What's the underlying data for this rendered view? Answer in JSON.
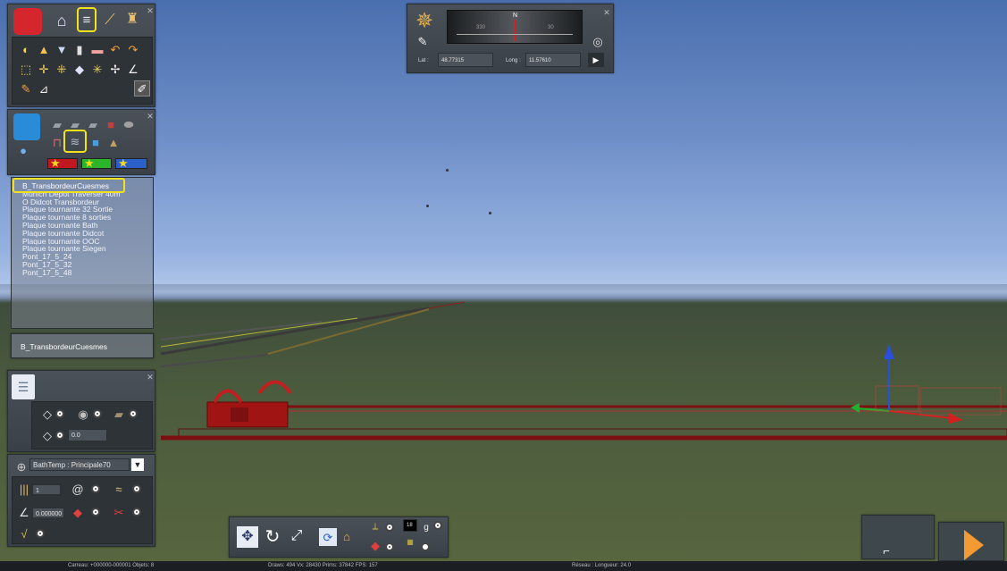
{
  "toolbar_top": {
    "icons": [
      "toolbox-icon",
      "home-icon",
      "track-icon",
      "brush-icon",
      "traffic-light-icon"
    ]
  },
  "object_list": {
    "items": [
      "B_TransbordeurCuesmes",
      "Munich Depot Traverser 40m",
      "O Didcot Transbordeur",
      "Plaque tournante 32 Sortie",
      "Plaque tournante 8 sorties",
      "Plaque tournante Bath",
      "Plaque tournante Didcot",
      "Plaque tournante OOC",
      "Plaque tournante Siegen",
      "Pont_17_5_24",
      "Pont_17_5_32",
      "Pont_17_5_48"
    ],
    "selected_label": "B_TransbordeurCuesmes"
  },
  "track_props": {
    "height_value": "0.0",
    "track_type": "BathTemp : Principale70",
    "count_value": "1",
    "angle_value": "0.000000"
  },
  "compass": {
    "tick_330": "330",
    "tick_30": "30",
    "north": "N",
    "lat_label": "Lat :",
    "lat_value": "48.77315",
    "long_label": "Long :",
    "long_value": "11.57610"
  },
  "bottom_toolbar": {
    "speed_value": "18"
  },
  "status": {
    "carreau": "Carreau: +000000-000001  Objets: 8",
    "draws": "Draws: 494 Vx: 28430 Prims: 37842 FPS: 157",
    "reseau": "Réseau : Longueur: 24.0"
  },
  "colors": {
    "highlight": "#f2e21c",
    "play_arrow": "#f39a33",
    "track_red": "#a01414"
  }
}
